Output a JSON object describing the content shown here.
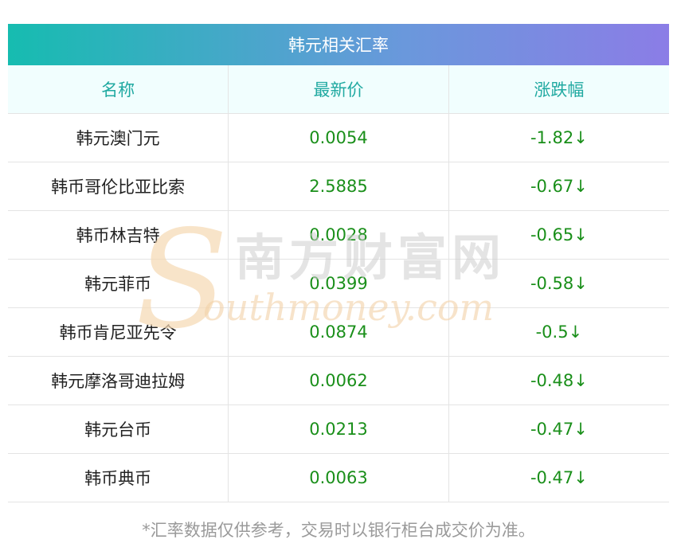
{
  "title": "韩元相关汇率",
  "columns": [
    "名称",
    "最新价",
    "涨跌幅"
  ],
  "rows": [
    {
      "name": "韩元澳门元",
      "price": "0.0054",
      "change": "-1.82↓"
    },
    {
      "name": "韩币哥伦比亚比索",
      "price": "2.5885",
      "change": "-0.67↓"
    },
    {
      "name": "韩币林吉特",
      "price": "0.0028",
      "change": "-0.65↓"
    },
    {
      "name": "韩元菲币",
      "price": "0.0399",
      "change": "-0.58↓"
    },
    {
      "name": "韩币肯尼亚先令",
      "price": "0.0874",
      "change": "-0.5↓"
    },
    {
      "name": "韩元摩洛哥迪拉姆",
      "price": "0.0062",
      "change": "-0.48↓"
    },
    {
      "name": "韩元台币",
      "price": "0.0213",
      "change": "-0.47↓"
    },
    {
      "name": "韩币典币",
      "price": "0.0063",
      "change": "-0.47↓"
    }
  ],
  "footer": "*汇率数据仅供参考，交易时以银行柜台成交价为准。",
  "watermark": {
    "cn": "南方财富网",
    "en": "outhmoney.com",
    "initial": "S"
  },
  "colors": {
    "header_start": "#16bcb0",
    "header_end": "#8b7de6",
    "header_text": "#20a9a1",
    "value": "#1a8f1a"
  }
}
